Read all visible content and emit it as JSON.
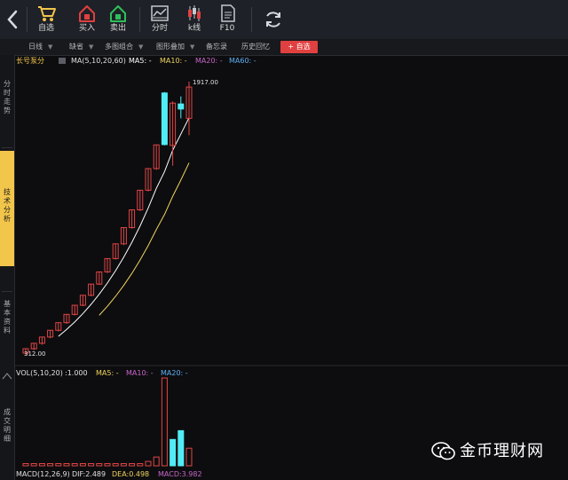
{
  "toolbar": {
    "back_icon": "chevron-left-icon",
    "buttons": [
      {
        "label": "自选",
        "icon": "cart-icon",
        "color": "#f2c54b"
      },
      {
        "label": "买入",
        "icon": "house-buy-icon",
        "color": "#e04040"
      },
      {
        "label": "卖出",
        "icon": "house-sell-icon",
        "color": "#2fbf5a"
      },
      {
        "label": "分时",
        "icon": "timeshare-chart-icon",
        "color": "#c5c7cc"
      },
      {
        "label": "k线",
        "icon": "candlestick-icon",
        "color": "#c5c7cc"
      },
      {
        "label": "F10",
        "icon": "document-icon",
        "color": "#c5c7cc"
      }
    ],
    "refresh_icon": "refresh-icon"
  },
  "tabs": {
    "items": [
      "日线",
      "缺省",
      "多图组合",
      "图形叠加",
      "备忘录",
      "历史回忆"
    ],
    "add_button": "+ 自选"
  },
  "sidebar": {
    "items": [
      "分时走势",
      "技术分析",
      "基本资料",
      "成交明细"
    ],
    "active": "技术分析"
  },
  "main_legend": {
    "name": "长号泵分",
    "period": "MA(5,10,20,60)",
    "ma5": "MA5: -",
    "ma10": "MA10: -",
    "ma20": "MA20: -",
    "ma60": "MA60: -"
  },
  "volume_legend": {
    "name": "VOL(5,10,20)",
    "value": ":1.000",
    "ma5": "MA5: -",
    "ma10": "MA10: -",
    "ma20": "MA20: -"
  },
  "macd_legend": {
    "name": "MACD(12,26,9)",
    "dif": "DIF:2.489",
    "dea": "DEA:0.498",
    "macd": "MACD:3.982"
  },
  "price_labels": {
    "high": "1917.00",
    "low": "312.00"
  },
  "colors": {
    "up": "#e04646",
    "down": "#51ecf5",
    "ma5": "#ffffff",
    "ma10": "#f1d45e",
    "ma20": "#c965c9",
    "ma60": "#5eb0f1"
  },
  "watermark": {
    "text": "金币理财网",
    "icon": "wechat-icon"
  },
  "chart_data": {
    "type": "candlestick",
    "price_range": [
      312.0,
      1917.0
    ],
    "candles": [
      {
        "open": 312,
        "high": 340,
        "low": 300,
        "close": 338
      },
      {
        "open": 338,
        "high": 372,
        "low": 330,
        "close": 370
      },
      {
        "open": 370,
        "high": 408,
        "low": 362,
        "close": 407
      },
      {
        "open": 407,
        "high": 448,
        "low": 400,
        "close": 447
      },
      {
        "open": 447,
        "high": 492,
        "low": 440,
        "close": 492
      },
      {
        "open": 492,
        "high": 541,
        "low": 485,
        "close": 541
      },
      {
        "open": 541,
        "high": 595,
        "low": 535,
        "close": 595
      },
      {
        "open": 595,
        "high": 655,
        "low": 590,
        "close": 654
      },
      {
        "open": 654,
        "high": 720,
        "low": 648,
        "close": 720
      },
      {
        "open": 720,
        "high": 792,
        "low": 715,
        "close": 792
      },
      {
        "open": 792,
        "high": 871,
        "low": 786,
        "close": 871
      },
      {
        "open": 871,
        "high": 958,
        "low": 865,
        "close": 958
      },
      {
        "open": 958,
        "high": 1054,
        "low": 950,
        "close": 1054
      },
      {
        "open": 1054,
        "high": 1159,
        "low": 1048,
        "close": 1159
      },
      {
        "open": 1159,
        "high": 1275,
        "low": 1152,
        "close": 1275
      },
      {
        "open": 1275,
        "high": 1403,
        "low": 1268,
        "close": 1403
      },
      {
        "open": 1403,
        "high": 1543,
        "low": 1396,
        "close": 1543
      },
      {
        "open": 1850,
        "high": 1855,
        "low": 1540,
        "close": 1545
      },
      {
        "open": 1540,
        "high": 1800,
        "low": 1420,
        "close": 1790
      },
      {
        "open": 1785,
        "high": 1830,
        "low": 1700,
        "close": 1755
      },
      {
        "open": 1700,
        "high": 1917,
        "low": 1600,
        "close": 1885
      }
    ],
    "volume": [
      1,
      1,
      1,
      1,
      1,
      1,
      1,
      1,
      1,
      1,
      1,
      1,
      1,
      1,
      1,
      2,
      4,
      40,
      12,
      16,
      8
    ],
    "volume_down": [
      false,
      false,
      false,
      false,
      false,
      false,
      false,
      false,
      false,
      false,
      false,
      false,
      false,
      false,
      false,
      false,
      false,
      false,
      true,
      true,
      false
    ]
  }
}
